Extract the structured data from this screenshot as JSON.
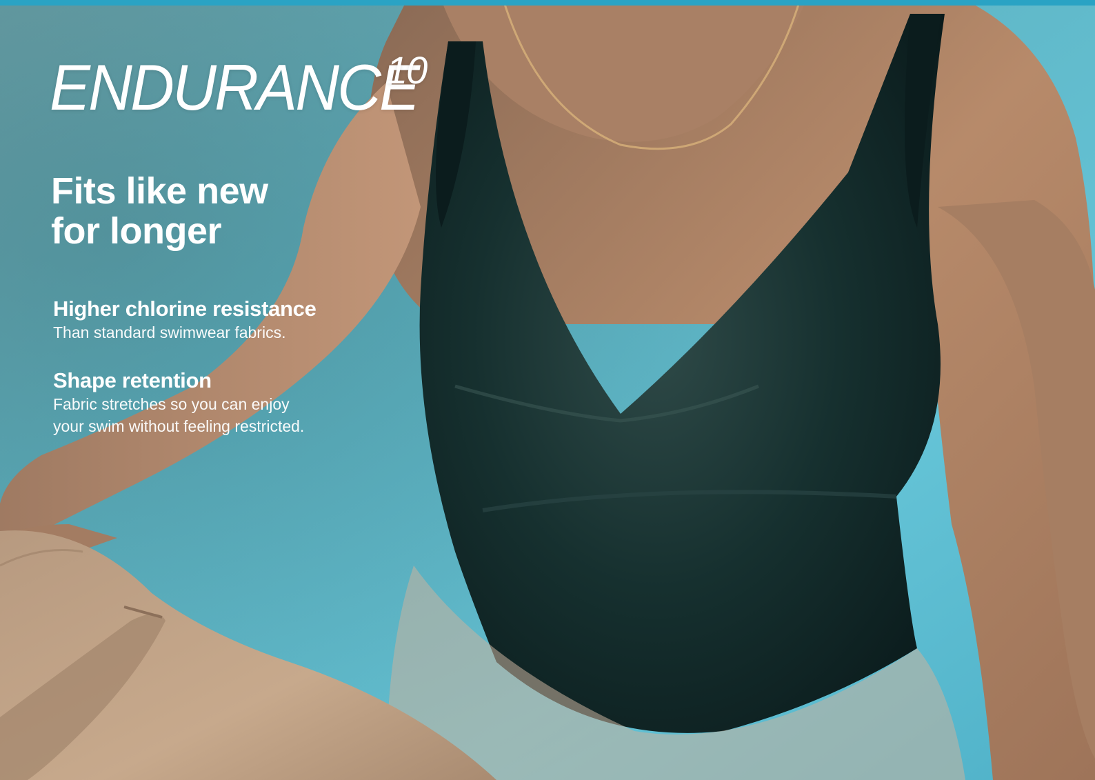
{
  "brand": {
    "name": "ENDURANCE",
    "superscript": "10"
  },
  "headline": {
    "line1": "Fits like new",
    "line2": "for longer"
  },
  "features": [
    {
      "title": "Higher chlorine resistance",
      "description": [
        "Than standard swimwear fabrics."
      ]
    },
    {
      "title": "Shape retention",
      "description": [
        "Fabric stretches so you can enjoy",
        "your swim without feeling restricted."
      ]
    }
  ],
  "colors": {
    "accent_bar": "#2aa3c4",
    "water": "#5fb8c8",
    "text": "#ffffff",
    "swimsuit": "#0f2a2c"
  }
}
